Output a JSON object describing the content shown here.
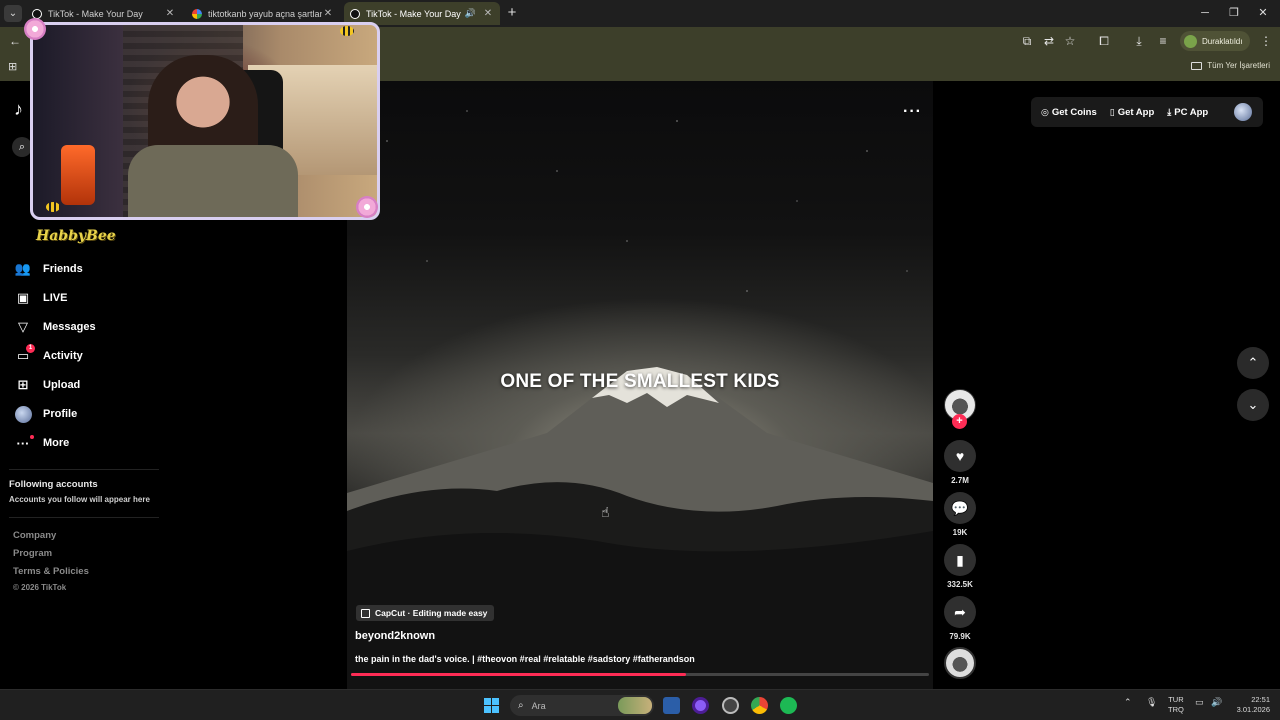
{
  "browser": {
    "tabs": [
      {
        "title": "TikTok - Make Your Day",
        "close": "✕"
      },
      {
        "title": "tiktotkanb yayub açna şartları",
        "close": "✕"
      },
      {
        "title": "TikTok - Make Your Day",
        "close": "✕",
        "audio": "🔊"
      }
    ],
    "new_tab": "+",
    "tab_list": "⌄",
    "window_controls": {
      "minimize": "─",
      "maximize": "❐",
      "close": "✕"
    },
    "paused_label": "Duraklatıldı",
    "bookmarks_all": "Tüm Yer İşaretleri"
  },
  "tiktok": {
    "logo": "♪",
    "nav": [
      {
        "label": "Friends",
        "icon": "friends-icon",
        "glyph": "👥"
      },
      {
        "label": "LIVE",
        "icon": "live-icon",
        "glyph": "▣"
      },
      {
        "label": "Messages",
        "icon": "messages-icon",
        "glyph": "▽"
      },
      {
        "label": "Activity",
        "icon": "activity-icon",
        "glyph": "▭",
        "badge": "1"
      },
      {
        "label": "Upload",
        "icon": "upload-icon",
        "glyph": "⊞"
      },
      {
        "label": "Profile",
        "icon": "profile-avatar"
      },
      {
        "label": "More",
        "icon": "more-icon",
        "glyph": "···"
      }
    ],
    "following": {
      "title": "Following accounts",
      "subtitle": "Accounts you follow will appear here"
    },
    "footer": {
      "links": [
        "Company",
        "Program",
        "Terms & Policies"
      ],
      "copyright": "© 2026 TikTok"
    },
    "top_actions": {
      "get_coins": "Get Coins",
      "get_app": "Get App",
      "pc_app": "PC App"
    },
    "video": {
      "overlay_text": "ONE OF THE SMALLEST KIDS",
      "capcut_label": "CapCut · Editing made easy",
      "author": "beyond2known",
      "description": "the pain in the dad's voice. | #theovon #real #relatable #sadstory #fatherandson",
      "progress_fraction": 0.58
    },
    "actions": {
      "likes": "2.7M",
      "comments": "19K",
      "saves": "332.5K",
      "shares": "79.9K"
    }
  },
  "stream_overlay": {
    "name_tag": "HabbyBee"
  },
  "taskbar": {
    "search_placeholder": "Ara",
    "language_line1": "TUR",
    "language_line2": "TRQ",
    "time": "22:51",
    "date": "3.01.2026"
  },
  "colors": {
    "accent_pink": "#fe2c55",
    "chrome_bar": "#3d3f2a",
    "windows_blue": "#4cc2ff"
  }
}
